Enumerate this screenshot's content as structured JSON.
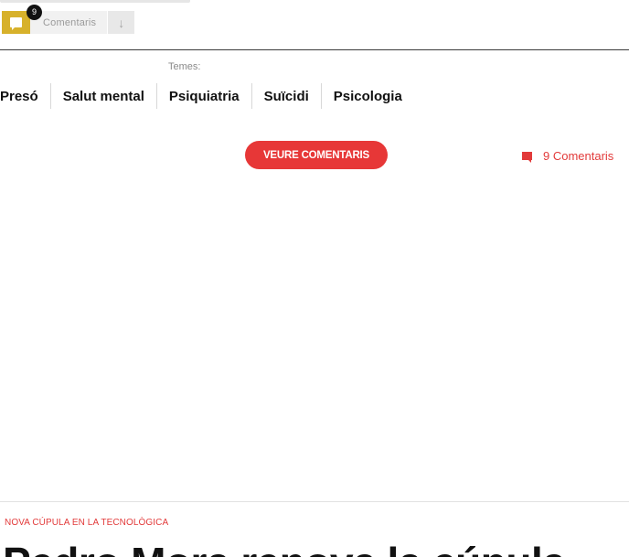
{
  "comment_bar": {
    "count": "9",
    "label": "Comentaris",
    "icon": "comment-icon",
    "arrow_icon": "arrow-down-icon",
    "accent_color": "#d7b12b"
  },
  "topics": {
    "label": "Temes:",
    "tags": [
      "Presó",
      "Salut mental",
      "Psiquiatria",
      "Suïcidi",
      "Psicologia"
    ]
  },
  "comments_section": {
    "button_label": "VEURE COMENTARIS",
    "link_label": "9 Comentaris",
    "icon": "comment-icon",
    "accent_color": "#e73737"
  },
  "next_article": {
    "kicker": "NOVA CÚPULA EN LA TECNOLÒGICA",
    "headline_partial": "Pedro Mora renova la cúpula"
  }
}
